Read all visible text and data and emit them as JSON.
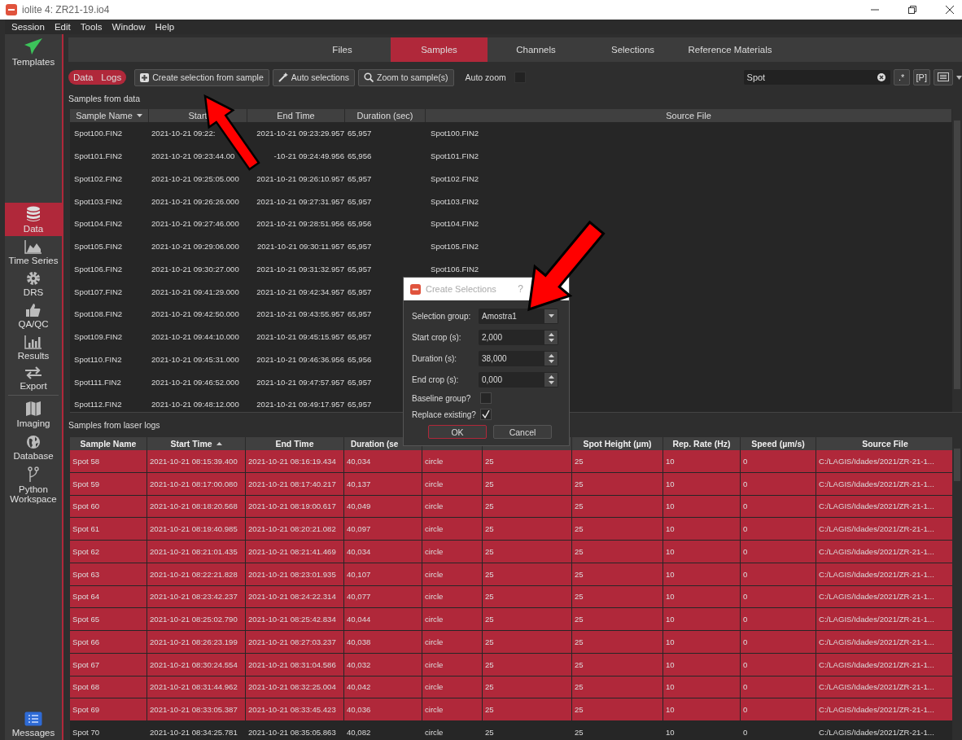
{
  "window": {
    "title": "iolite 4: ZR21-19.io4"
  },
  "menu": [
    "Session",
    "Edit",
    "Tools",
    "Window",
    "Help"
  ],
  "sidebar": {
    "top": {
      "label": "Templates"
    },
    "items": [
      {
        "label": "Data",
        "selected": true
      },
      {
        "label": "Time Series",
        "selected": false
      },
      {
        "label": "DRS",
        "selected": false
      },
      {
        "label": "QA/QC",
        "selected": false
      },
      {
        "label": "Results",
        "selected": false
      },
      {
        "label": "Export",
        "selected": false
      },
      {
        "label": "Imaging",
        "selected": false
      },
      {
        "label": "Database",
        "selected": false
      },
      {
        "label": "Python Workspace",
        "selected": false
      }
    ],
    "bottom": {
      "label": "Messages"
    }
  },
  "tabs": [
    {
      "label": "Files",
      "selected": false
    },
    {
      "label": "Samples",
      "selected": true
    },
    {
      "label": "Channels",
      "selected": false
    },
    {
      "label": "Selections",
      "selected": false
    },
    {
      "label": "Reference Materials",
      "selected": false
    }
  ],
  "toolbar": {
    "toggle": [
      "Data",
      "Logs"
    ],
    "buttons": [
      {
        "label": "Create selection from sample"
      },
      {
        "label": "Auto selections"
      },
      {
        "label": "Zoom to sample(s)"
      }
    ],
    "auto_zoom": {
      "label": "Auto zoom",
      "checked": false
    },
    "search": {
      "value": "Spot"
    },
    "regex_button": ".*",
    "p_button": "[P]"
  },
  "data_table": {
    "title": "Samples from data",
    "columns": [
      "Sample Name",
      "Start",
      "End Time",
      "Duration (sec)",
      "Source File"
    ],
    "rows": [
      [
        "Spot100.FIN2",
        "2021-10-21 09:22:",
        "2021-10-21 09:23:29.957",
        "65,957",
        "Spot100.FIN2"
      ],
      [
        "Spot101.FIN2",
        "2021-10-21 09:23:44.00",
        "-10-21 09:24:49.956",
        "65,956",
        "Spot101.FIN2"
      ],
      [
        "Spot102.FIN2",
        "2021-10-21 09:25:05.000",
        "2021-10-21 09:26:10.957",
        "65,957",
        "Spot102.FIN2"
      ],
      [
        "Spot103.FIN2",
        "2021-10-21 09:26:26.000",
        "2021-10-21 09:27:31.957",
        "65,957",
        "Spot103.FIN2"
      ],
      [
        "Spot104.FIN2",
        "2021-10-21 09:27:46.000",
        "2021-10-21 09:28:51.956",
        "65,956",
        "Spot104.FIN2"
      ],
      [
        "Spot105.FIN2",
        "2021-10-21 09:29:06.000",
        "2021-10-21 09:30:11.957",
        "65,957",
        "Spot105.FIN2"
      ],
      [
        "Spot106.FIN2",
        "2021-10-21 09:30:27.000",
        "2021-10-21 09:31:32.957",
        "65,957",
        "Spot106.FIN2"
      ],
      [
        "Spot107.FIN2",
        "2021-10-21 09:41:29.000",
        "2021-10-21 09:42:34.957",
        "65,957"
      ],
      [
        "Spot108.FIN2",
        "2021-10-21 09:42:50.000",
        "2021-10-21 09:43:55.957",
        "65,957"
      ],
      [
        "Spot109.FIN2",
        "2021-10-21 09:44:10.000",
        "2021-10-21 09:45:15.957",
        "65,957"
      ],
      [
        "Spot110.FIN2",
        "2021-10-21 09:45:31.000",
        "2021-10-21 09:46:36.956",
        "65,956"
      ],
      [
        "Spot111.FIN2",
        "2021-10-21 09:46:52.000",
        "2021-10-21 09:47:57.957",
        "65,957"
      ],
      [
        "Spot112.FIN2",
        "2021-10-21 09:48:12.000",
        "2021-10-21 09:49:17.957",
        "65,957"
      ]
    ]
  },
  "logs_table": {
    "title": "Samples from laser logs",
    "columns": [
      {
        "label": "Sample Name"
      },
      {
        "label": "Start Time",
        "sorted": true
      },
      {
        "label": "End Time"
      },
      {
        "label": "Duration (se"
      },
      {},
      {},
      {
        "label": "Spot Height (µm)"
      },
      {
        "label": "Rep. Rate (Hz)"
      },
      {
        "label": "Speed (µm/s)"
      },
      {
        "label": "Source File"
      }
    ],
    "rows": [
      {
        "selected": true,
        "cells": [
          "Spot 58",
          "2021-10-21 08:15:39.400",
          "2021-10-21 08:16:19.434",
          "40,034",
          "circle",
          "25",
          "25",
          "10",
          "0",
          "C:/LAGIS/Idades/2021/ZR-21-1..."
        ]
      },
      {
        "selected": true,
        "cells": [
          "Spot 59",
          "2021-10-21 08:17:00.080",
          "2021-10-21 08:17:40.217",
          "40,137",
          "circle",
          "25",
          "25",
          "10",
          "0",
          "C:/LAGIS/Idades/2021/ZR-21-1..."
        ]
      },
      {
        "selected": true,
        "cells": [
          "Spot 60",
          "2021-10-21 08:18:20.568",
          "2021-10-21 08:19:00.617",
          "40,049",
          "circle",
          "25",
          "25",
          "10",
          "0",
          "C:/LAGIS/Idades/2021/ZR-21-1..."
        ]
      },
      {
        "selected": true,
        "cells": [
          "Spot 61",
          "2021-10-21 08:19:40.985",
          "2021-10-21 08:20:21.082",
          "40,097",
          "circle",
          "25",
          "25",
          "10",
          "0",
          "C:/LAGIS/Idades/2021/ZR-21-1..."
        ]
      },
      {
        "selected": true,
        "cells": [
          "Spot 62",
          "2021-10-21 08:21:01.435",
          "2021-10-21 08:21:41.469",
          "40,034",
          "circle",
          "25",
          "25",
          "10",
          "0",
          "C:/LAGIS/Idades/2021/ZR-21-1..."
        ]
      },
      {
        "selected": true,
        "cells": [
          "Spot 63",
          "2021-10-21 08:22:21.828",
          "2021-10-21 08:23:01.935",
          "40,107",
          "circle",
          "25",
          "25",
          "10",
          "0",
          "C:/LAGIS/Idades/2021/ZR-21-1..."
        ]
      },
      {
        "selected": true,
        "cells": [
          "Spot 64",
          "2021-10-21 08:23:42.237",
          "2021-10-21 08:24:22.314",
          "40,077",
          "circle",
          "25",
          "25",
          "10",
          "0",
          "C:/LAGIS/Idades/2021/ZR-21-1..."
        ]
      },
      {
        "selected": true,
        "cells": [
          "Spot 65",
          "2021-10-21 08:25:02.790",
          "2021-10-21 08:25:42.834",
          "40,044",
          "circle",
          "25",
          "25",
          "10",
          "0",
          "C:/LAGIS/Idades/2021/ZR-21-1..."
        ]
      },
      {
        "selected": true,
        "cells": [
          "Spot 66",
          "2021-10-21 08:26:23.199",
          "2021-10-21 08:27:03.237",
          "40,038",
          "circle",
          "25",
          "25",
          "10",
          "0",
          "C:/LAGIS/Idades/2021/ZR-21-1..."
        ]
      },
      {
        "selected": true,
        "cells": [
          "Spot 67",
          "2021-10-21 08:30:24.554",
          "2021-10-21 08:31:04.586",
          "40,032",
          "circle",
          "25",
          "25",
          "10",
          "0",
          "C:/LAGIS/Idades/2021/ZR-21-1..."
        ]
      },
      {
        "selected": true,
        "cells": [
          "Spot 68",
          "2021-10-21 08:31:44.962",
          "2021-10-21 08:32:25.004",
          "40,042",
          "circle",
          "25",
          "25",
          "10",
          "0",
          "C:/LAGIS/Idades/2021/ZR-21-1..."
        ]
      },
      {
        "selected": true,
        "cells": [
          "Spot 69",
          "2021-10-21 08:33:05.387",
          "2021-10-21 08:33:45.423",
          "40,036",
          "circle",
          "25",
          "25",
          "10",
          "0",
          "C:/LAGIS/Idades/2021/ZR-21-1..."
        ]
      },
      {
        "selected": false,
        "cells": [
          "Spot 70",
          "2021-10-21 08:34:25.781",
          "2021-10-21 08:35:05.863",
          "40,082",
          "circle",
          "25",
          "25",
          "10",
          "0",
          "C:/LAGIS/Idades/2021/ZR-21-1..."
        ]
      }
    ]
  },
  "dialog": {
    "title": "Create Selections",
    "help": "?",
    "fields": [
      {
        "kind": "combo",
        "label": "Selection group:",
        "value": "Amostra1"
      },
      {
        "kind": "spin",
        "label": "Start crop (s):",
        "value": "2,000"
      },
      {
        "kind": "spin",
        "label": "Duration (s):",
        "value": "38,000"
      },
      {
        "kind": "spin",
        "label": "End crop (s):",
        "value": "0,000"
      },
      {
        "kind": "check",
        "label": "Baseline group?",
        "checked": false
      },
      {
        "kind": "check",
        "label": "Replace existing?",
        "checked": true
      }
    ],
    "buttons": [
      {
        "label": "OK",
        "default": true
      },
      {
        "label": "Cancel",
        "default": false
      }
    ]
  }
}
